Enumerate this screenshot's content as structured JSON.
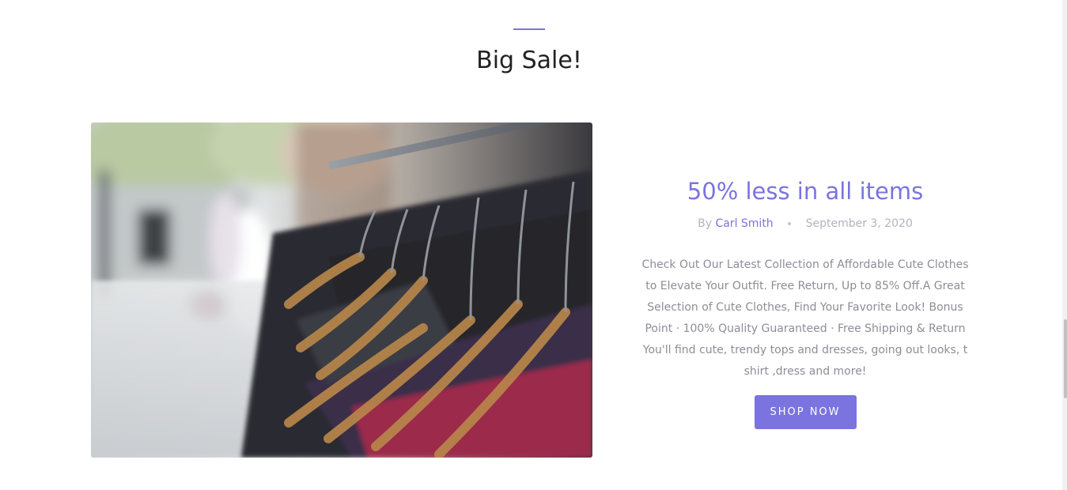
{
  "section": {
    "title": "Big Sale!"
  },
  "hero": {
    "image_alt": "Clothes on hangers on a rack"
  },
  "post": {
    "title": "50% less in all items",
    "by_label": "By",
    "author": "Carl Smith",
    "date": "September 3, 2020",
    "excerpt": "Check Out Our Latest Collection of Affordable Cute Clothes to Elevate Your Outfit. Free Return, Up to 85% Off.A Great Selection of Cute Clothes, Find Your Favorite Look! Bonus Point · 100% Quality Guaranteed · Free Shipping & Return You'll find cute, trendy tops and dresses, going out looks, t shirt ,dress and more!",
    "button_label": "SHOP NOW"
  },
  "colors": {
    "accent": "#7b73e0",
    "heading": "#222222",
    "muted": "#8d8d98"
  }
}
